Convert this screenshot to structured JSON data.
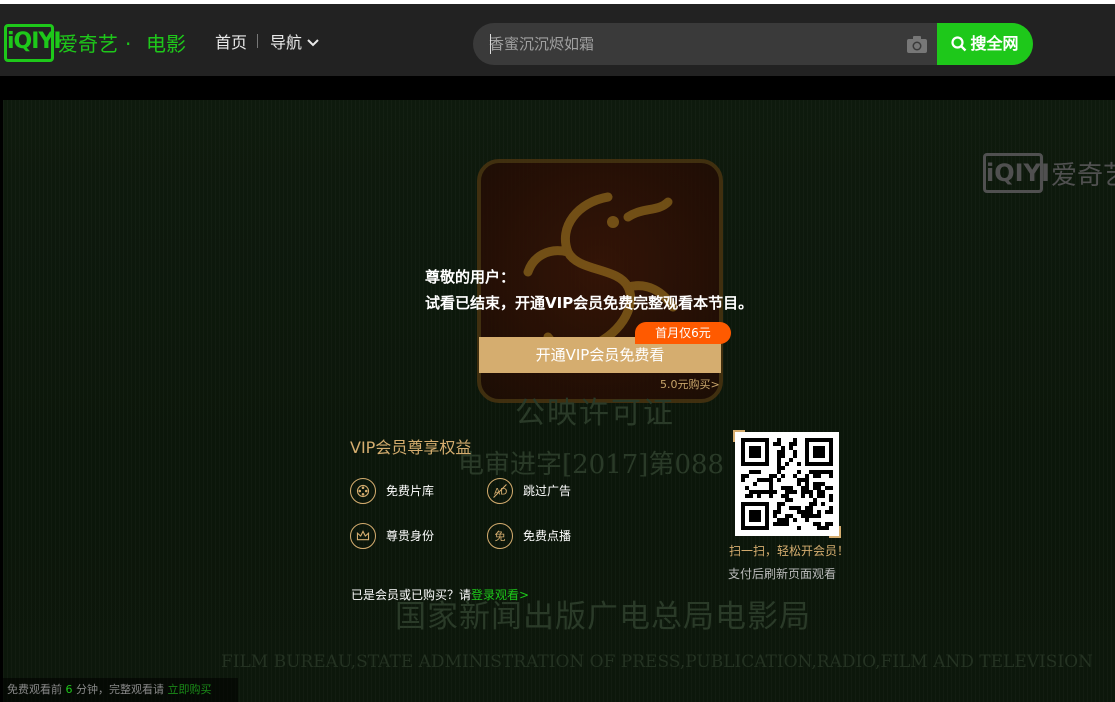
{
  "header": {
    "logo_text": "iQIYI",
    "brand_name": "爱奇艺",
    "brand_dot": "·",
    "brand_sub": "电影",
    "nav": {
      "home": "首页",
      "guide": "导航"
    },
    "search": {
      "placeholder": "香蜜沉沉烬如霜",
      "button_label": "搜全网"
    }
  },
  "player": {
    "watermark": {
      "logo_text": "iQIYI",
      "text": "爱奇艺"
    },
    "license_title": "公映许可证",
    "license_number": "电审进字[2017]第088",
    "bureau_cn": "国家新闻出版广电总局电影局",
    "bureau_en": "FILM BUREAU,STATE ADMINISTRATION OF PRESS,PUBLICATION,RADIO,FILM AND TELEVISION"
  },
  "overlay": {
    "greeting": "尊敬的用户：",
    "message": "试看已结束，开通VIP会员免费完整观看本节目。",
    "vip_button": "开通VIP会员免费看",
    "promo_badge": "首月仅6元",
    "buy_link": "5.0元购买>",
    "benefits_title": "VIP会员尊享权益",
    "benefits": [
      {
        "label": "免费片库",
        "icon": "film-reel-icon"
      },
      {
        "label": "跳过广告",
        "icon": "ad-skip-icon"
      },
      {
        "label": "尊贵身份",
        "icon": "crown-icon"
      },
      {
        "label": "免费点播",
        "icon": "free-badge-icon",
        "glyph": "免"
      }
    ],
    "login_prompt": "已是会员或已购买？请",
    "login_link": "登录观看>",
    "scan_tip": "扫一扫，轻松开会员！",
    "pay_tip": "支付后刷新页面观看"
  },
  "bottom": {
    "prefix": "免费观看前",
    "minutes": "6",
    "suffix": "分钟，完整观看请",
    "buy": "立即购买"
  },
  "colors": {
    "brand_green": "#1ec81a",
    "gold": "#d5ad6f",
    "promo_orange": "#ff5a00",
    "header_bg": "#222222"
  }
}
